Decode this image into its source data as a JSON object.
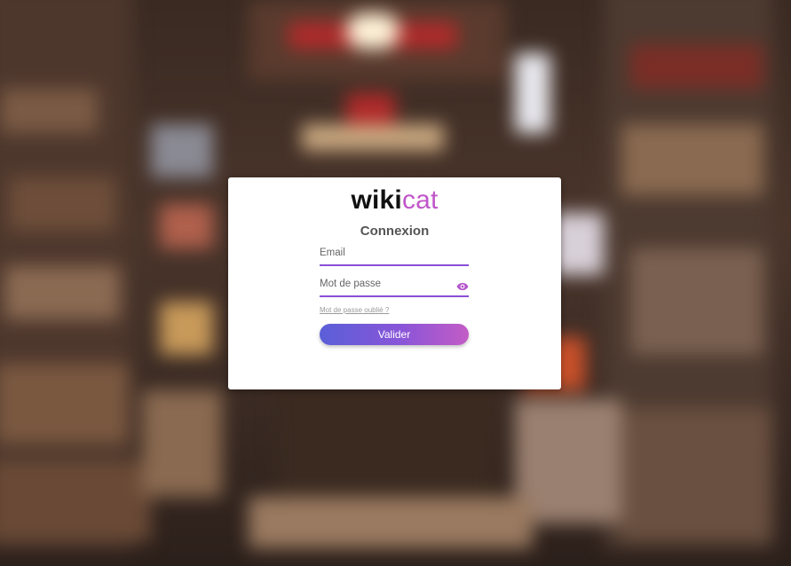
{
  "logo": {
    "part1": "wiki",
    "part2": "cat"
  },
  "heading": "Connexion",
  "form": {
    "email_placeholder": "Email",
    "password_placeholder": "Mot de passe",
    "forgot_link": "Mot de passe oublié ?",
    "submit_label": "Valider"
  },
  "icons": {
    "password_toggle": "eye-icon"
  },
  "colors": {
    "accent": "#c056c9",
    "underline": "#8a4fd6",
    "button_start": "#5a5fd8",
    "button_end": "#c35cc6"
  }
}
